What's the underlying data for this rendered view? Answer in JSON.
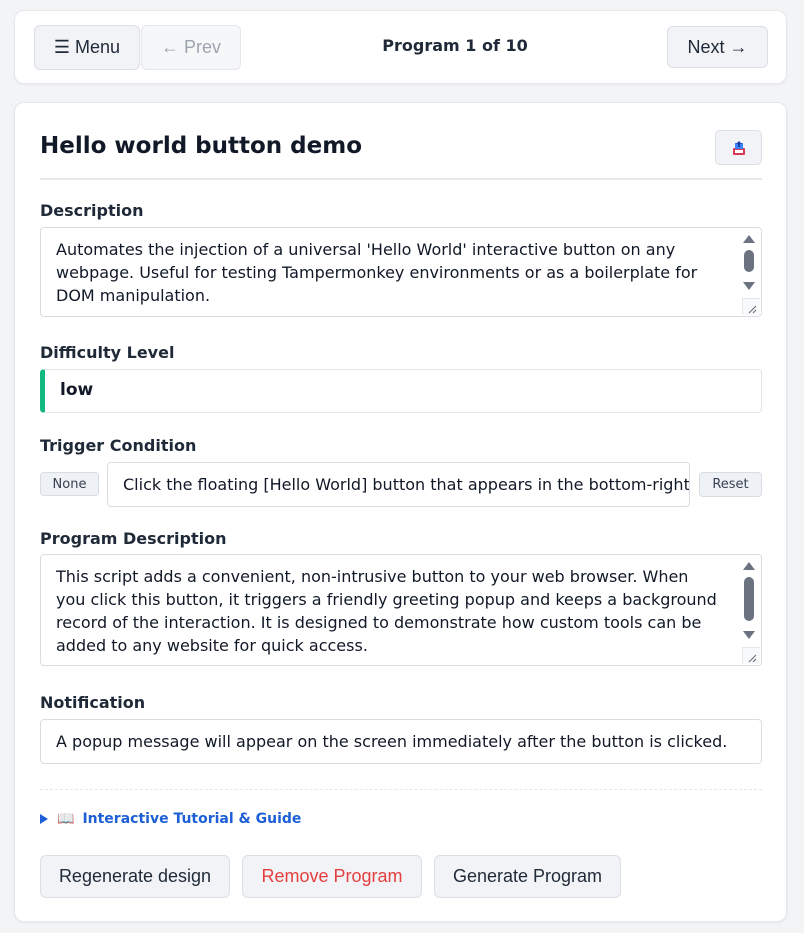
{
  "nav": {
    "menu_label": "☰ Menu",
    "prev_label": "← Prev",
    "program_counter": "Program 1 of 10",
    "next_label": "Next →"
  },
  "program": {
    "title": "Hello world button demo",
    "export_icon": "export-icon",
    "description_label": "Description",
    "description": "Automates the injection of a universal 'Hello World' interactive button on any webpage. Useful for testing Tampermonkey environments or as a boilerplate for DOM manipulation.",
    "difficulty_label": "Difficulty Level",
    "difficulty": "low",
    "difficulty_accent": "#10b981",
    "trigger_label": "Trigger Condition",
    "trigger_tag": "None",
    "trigger_value": "Click the floating [Hello World] button that appears in the bottom-right",
    "reset_label": "Reset",
    "program_description_label": "Program Description",
    "program_description": "This script adds a convenient, non-intrusive button to your web browser. When you click this button, it triggers a friendly greeting popup and keeps a background record of the interaction. It is designed to demonstrate how custom tools can be added to any website for quick access.",
    "notification_label": "Notification",
    "notification": "A popup message will appear on the screen immediately after the button is clicked."
  },
  "tutorial": {
    "icon": "📖",
    "label": "Interactive Tutorial & Guide"
  },
  "actions": {
    "regenerate_label": "Regenerate design",
    "remove_label": "Remove Program",
    "remove_color": "#e53e3e",
    "generate_label": "Generate Program"
  }
}
